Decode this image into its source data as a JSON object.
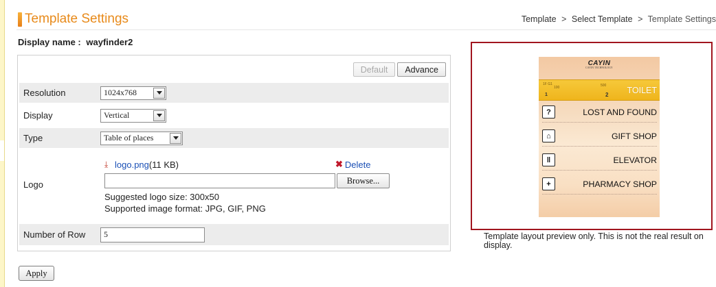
{
  "header": {
    "title": "Template Settings",
    "breadcrumb": [
      {
        "label": "Template"
      },
      {
        "label": "Select Template"
      },
      {
        "label": "Template Settings"
      }
    ],
    "separator": ">"
  },
  "display_name": {
    "label": "Display name :",
    "value": "wayfinder2"
  },
  "toolbar": {
    "default_label": "Default",
    "advance_label": "Advance"
  },
  "form": {
    "resolution": {
      "label": "Resolution",
      "value": "1024x768"
    },
    "display": {
      "label": "Display",
      "value": "Vertical"
    },
    "type": {
      "label": "Type",
      "value": "Table of places"
    },
    "logo": {
      "label": "Logo",
      "file_name": "logo.png",
      "file_size": "(11 KB)",
      "delete_label": "Delete",
      "file_value": "",
      "browse_label": "Browse...",
      "hint_size": "Suggested logo size: 300x50",
      "hint_format": "Supported image format: JPG, GIF, PNG"
    },
    "rows": {
      "label": "Number of Row",
      "value": "5"
    }
  },
  "apply_label": "Apply",
  "preview": {
    "brand": "CAYIN",
    "brand_sub": "CAYIN TECHNOLOGY",
    "toilet": {
      "name": "TOILET",
      "floor": "1",
      "number": "2",
      "tiny_a": "1F G1",
      "tiny_b": "100",
      "tiny_c": "500"
    },
    "places": [
      {
        "name": "LOST AND FOUND",
        "icon": "lost-found-icon",
        "glyph": "?"
      },
      {
        "name": "GIFT SHOP",
        "icon": "gift-shop-icon",
        "glyph": "⌂"
      },
      {
        "name": "ELEVATOR",
        "icon": "elevator-icon",
        "glyph": "‖"
      },
      {
        "name": "PHARMACY SHOP",
        "icon": "pharmacy-icon",
        "glyph": "+"
      }
    ],
    "note": "Template layout preview only. This is not the real result on display."
  },
  "colors": {
    "accent": "#e88a1a",
    "link": "#1a4fb5",
    "preview_border": "#a0141e",
    "toilet_bar": "#f6c83a"
  }
}
